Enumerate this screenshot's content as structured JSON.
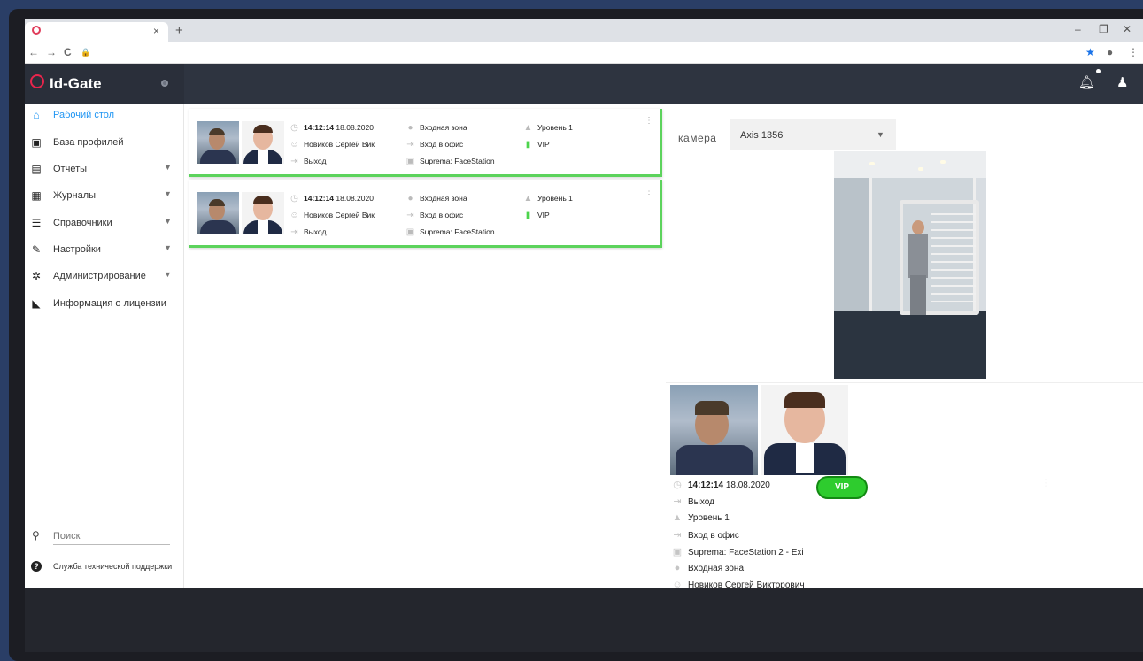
{
  "browser": {
    "new_tab": "+",
    "tab_close": "×",
    "win_min": "–",
    "win_max": "❐",
    "win_close": "✕",
    "nav_back": "←",
    "nav_forward": "→",
    "reload": "C",
    "lock": "🔒",
    "bookmark_star": "★",
    "account": "●",
    "menu": "⋮"
  },
  "app": {
    "logo_text": "Id-Gate"
  },
  "sidebar": {
    "items": [
      {
        "label": "Рабочий стол",
        "icon": "home-icon",
        "active": true
      },
      {
        "label": "База профилей",
        "icon": "id-card-icon"
      },
      {
        "label": "Отчеты",
        "icon": "report-icon",
        "has_submenu": true
      },
      {
        "label": "Журналы",
        "icon": "table-icon",
        "has_submenu": true
      },
      {
        "label": "Справочники",
        "icon": "list-icon",
        "has_submenu": true
      },
      {
        "label": "Настройки",
        "icon": "wrench-icon",
        "has_submenu": true
      },
      {
        "label": "Администрирование",
        "icon": "gear-icon",
        "has_submenu": true
      },
      {
        "label": "Информация о лицензии",
        "icon": "license-icon"
      }
    ],
    "search_placeholder": "Поиск",
    "support_label": "Служба технической поддержки"
  },
  "events": [
    {
      "time": "14:12:14",
      "date": "18.08.2020",
      "name": "Новиков Сергей Вик",
      "direction": "Выход",
      "zone": "Входная зона",
      "access_point": "Вход в офис",
      "device": "Suprema: FaceStation",
      "level": "Уровень 1",
      "tag": "VIP"
    },
    {
      "time": "14:12:14",
      "date": "18.08.2020",
      "name": "Новиков Сергей Вик",
      "direction": "Выход",
      "zone": "Входная зона",
      "access_point": "Вход в офис",
      "device": "Suprema: FaceStation",
      "level": "Уровень 1",
      "tag": "VIP"
    }
  ],
  "camera": {
    "label": "камера",
    "selected": "Axis 1356"
  },
  "detail": {
    "time": "14:12:14",
    "date": "18.08.2020",
    "tag": "VIP",
    "direction": "Выход",
    "level": "Уровень 1",
    "access_point": "Вход в офис",
    "device": "Suprema: FaceStation 2 - Exi",
    "zone": "Входная зона",
    "name": "Новиков Сергей Викторович"
  },
  "colors": {
    "accent": "#2196f3",
    "brand": "#e8254c",
    "ok": "#5cd35c",
    "header": "#2e3440"
  }
}
